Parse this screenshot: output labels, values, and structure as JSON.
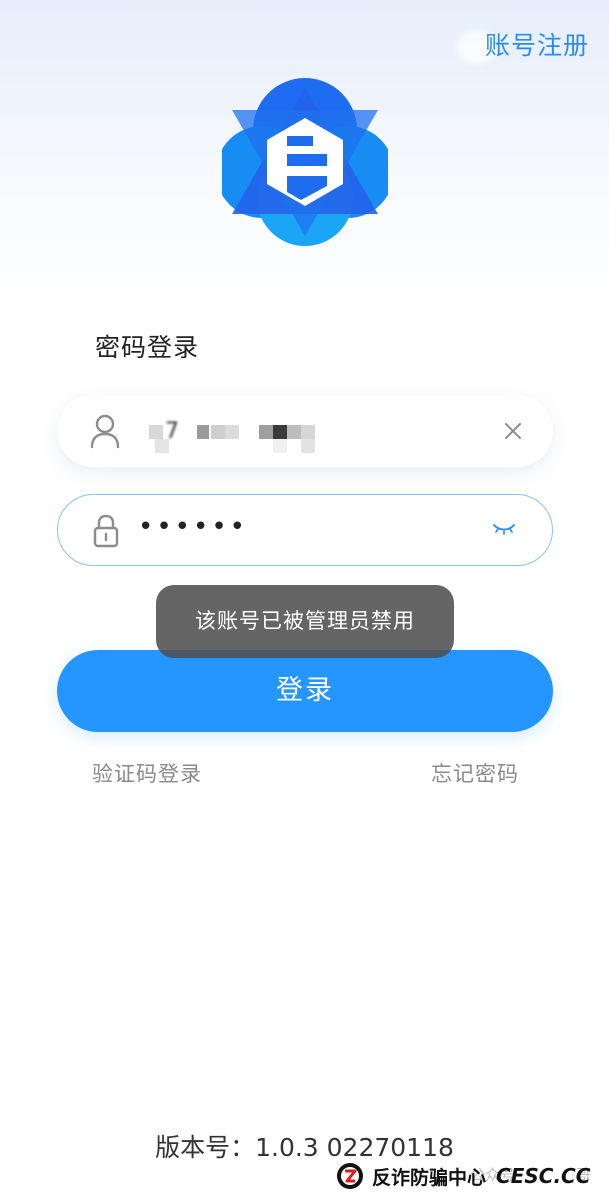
{
  "header": {
    "register_label": "账号注册"
  },
  "login_form": {
    "title": "密码登录",
    "account_partial": "· 7",
    "password_masked": "••••••",
    "login_button_label": "登录",
    "sms_login_label": "验证码登录",
    "forgot_password_label": "忘记密码"
  },
  "toast": {
    "message": "该账号已被管理员禁用"
  },
  "footer": {
    "version": "版本号：1.0.3 02270118"
  },
  "watermark": {
    "text": "反诈防骗中心",
    "brand": "CESC.CC",
    "faint_text": "公众号",
    "faint_text_2": "哥"
  },
  "colors": {
    "accent": "#2595ff",
    "register_link": "#2a8cf0",
    "logo_blue_dark": "#1e6cf0",
    "logo_blue_light": "#1aa6f5",
    "toast_bg": "#505050"
  },
  "icons": {
    "account_field": "user-icon",
    "password_field": "lock-icon",
    "clear": "close-icon",
    "password_visibility": "eye-closed-icon"
  }
}
